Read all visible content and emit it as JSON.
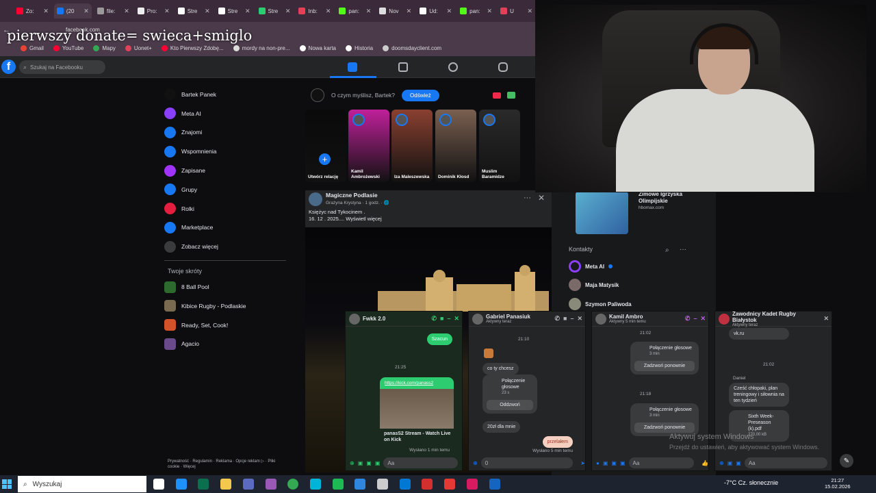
{
  "overlay": {
    "text": "pierwszy donate= swieca+smiglo"
  },
  "browser": {
    "tabs": [
      {
        "label": "Zo:",
        "color": "#ff0033"
      },
      {
        "label": "(20",
        "color": "#1877f2",
        "active": true
      },
      {
        "label": "file:",
        "color": "#999999"
      },
      {
        "label": "Pro:",
        "color": "#eeeeee"
      },
      {
        "label": "Stre",
        "color": "#ffffff"
      },
      {
        "label": "Stre",
        "color": "#ffffff"
      },
      {
        "label": "Stre",
        "color": "#2ecc71"
      },
      {
        "label": "Inb:",
        "color": "#e0425a"
      },
      {
        "label": "pan:",
        "color": "#53fc18"
      },
      {
        "label": "Nov",
        "color": "#dddddd"
      },
      {
        "label": "Ud:",
        "color": "#ffffff"
      },
      {
        "label": "pan:",
        "color": "#53fc18"
      },
      {
        "label": "U",
        "color": "#e0425a"
      }
    ],
    "url": "facebook.com",
    "bookmarks": [
      "Gmail",
      "YouTube",
      "Mapy",
      "Uonet+",
      "Kto Pierwszy Zdobę...",
      "mordy na non-pre...",
      "Nowa karta",
      "Historia",
      "doomsdayclient.com"
    ]
  },
  "facebook": {
    "search_placeholder": "Szukaj na Facebooku",
    "left_nav": [
      {
        "label": "Bartek Panek",
        "icon": "avatar",
        "color": "#111111"
      },
      {
        "label": "Meta AI",
        "icon": "meta-ai-icon",
        "color": "#8a3ffc"
      },
      {
        "label": "Znajomi",
        "icon": "friends-icon",
        "color": "#1877f2"
      },
      {
        "label": "Wspomnienia",
        "icon": "memories-icon",
        "color": "#1877f2"
      },
      {
        "label": "Zapisane",
        "icon": "saved-icon",
        "color": "#a033ff"
      },
      {
        "label": "Grupy",
        "icon": "groups-icon",
        "color": "#1877f2"
      },
      {
        "label": "Rolki",
        "icon": "reels-icon",
        "color": "#e41e3f"
      },
      {
        "label": "Marketplace",
        "icon": "marketplace-icon",
        "color": "#1877f2"
      },
      {
        "label": "Zobacz więcej",
        "icon": "chevron-down-icon",
        "color": "#3a3b3c"
      }
    ],
    "shortcuts_title": "Twoje skróty",
    "shortcuts": [
      {
        "label": "8 Ball Pool",
        "color": "#2d6a2d"
      },
      {
        "label": "Kibice Rugby - Podlaskie",
        "color": "#7a6a50"
      },
      {
        "label": "Ready, Set, Cook!",
        "color": "#d4522a"
      },
      {
        "label": "Agacio",
        "color": "#6a4a8a"
      }
    ],
    "footer": "Prywatność · Regulamin · Reklama · Opcje reklam ▷ · Pliki cookie · Więcej",
    "composer": {
      "placeholder": "O czym myślisz, Bartek?",
      "button": "Odśwież"
    },
    "stories": [
      {
        "name": "Utwórz relację",
        "color": "#0a0a0a"
      },
      {
        "name": "Kamil Ambrożewski",
        "color": "#c0209a"
      },
      {
        "name": "Iza Maleszewska",
        "color": "#8a4030"
      },
      {
        "name": "Dominik Kłosd",
        "color": "#7a6050"
      },
      {
        "name": "Muslim Baramidze",
        "color": "#2a2a2a"
      }
    ],
    "post": {
      "author": "Magiczne Podlasie",
      "meta": "Grażyna Krystyna · 1 godz. · 🌐",
      "text_line1": "Księżyc nad Tykocinem .",
      "text_line2": "16. 12 . 2025.... Wyświetl więcej"
    },
    "sponsored": {
      "title_line1": "Zimowe Igrzyska",
      "title_line2": "Olimpijskie",
      "url": "hbomax.com"
    },
    "contacts_title": "Kontakty",
    "contacts": [
      "Meta AI",
      "Maja Matysik",
      "Szymon Paliwoda"
    ]
  },
  "chats": [
    {
      "name": "Fwkk 2.0",
      "messages": {
        "b1": "Szacun",
        "time": "21:25",
        "link": "https://kick.com/panass2",
        "preview_title": "panasS2 Stream - Watch Live on Kick",
        "sent": "Wysłano 1 min temu"
      },
      "input": "Aa"
    },
    {
      "name": "Gabriel Panasiuk",
      "status": "Aktywny teraz",
      "messages": {
        "time": "21:10",
        "b1": "co ty chcesz",
        "call": "Połączenie głosowe",
        "call_dur": "23 s",
        "call_btn": "Oddzwoń",
        "b2": "20zł dla mnie",
        "b3": "przelałem",
        "sent": "Wysłano 5 min temu"
      },
      "input": "0"
    },
    {
      "name": "Kamil Ambro",
      "status": "Aktywny 5 min temu",
      "messages": {
        "t1": "21:02",
        "call": "Połączenie głosowe",
        "dur": "3 min",
        "btn": "Zadzwoń ponownie",
        "t2": "21:18"
      },
      "input": "Aa"
    },
    {
      "name": "Zawodnicy Kadet Rugby Białystok",
      "status": "Aktywny teraz",
      "messages": {
        "b0": "vk.ru",
        "t1": "21:02",
        "sender": "Daniel",
        "b1": "Cześć chłopaki, plan treningowy i siłownia na ten tydzień",
        "file": "Sixth Week-Preseason (k).pdf",
        "size": "270,00 kB"
      },
      "input": "Aa"
    }
  ],
  "windows": {
    "watermark": "Aktywuj system Windows",
    "watermark_sub": "Przejdź do ustawień, aby aktywować system Windows.",
    "search": "Wyszukaj",
    "weather": "-7°C  Cz. słonecznie",
    "time": "21:27",
    "date": "15.02.2026"
  }
}
